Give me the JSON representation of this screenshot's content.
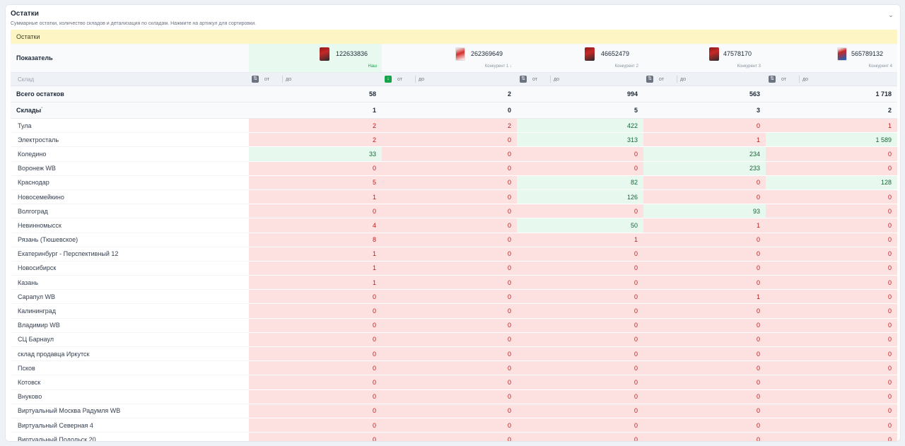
{
  "card": {
    "title": "Остатки",
    "subtitle": "Суммарные остатки, количество складов и детализация по складам. Нажмите на артикул для сортировки.",
    "collapse_glyph": "⌄"
  },
  "section_label": "Остатки",
  "header_label": "Показатель",
  "products": [
    {
      "article": "122633836",
      "role": "Наш",
      "ours": true
    },
    {
      "article": "262369649",
      "role": "Конкурент 1 ↓",
      "ours": false
    },
    {
      "article": "46652479",
      "role": "Конкурент 2",
      "ours": false
    },
    {
      "article": "47578170",
      "role": "Конкурент 3",
      "ours": false
    },
    {
      "article": "565789132",
      "role": "Конкурент 4",
      "ours": false
    }
  ],
  "filter": {
    "sklad_placeholder": "Склад",
    "from_placeholder": "от",
    "to_placeholder": "до",
    "sort_glyph": "⇅",
    "sort_active_glyph": "↓"
  },
  "totals": {
    "label": "Всего остатков",
    "values": [
      "58",
      "2",
      "994",
      "563",
      "1 718"
    ]
  },
  "warehouses_count": {
    "label": "Склады",
    "mark": "*",
    "values": [
      "1",
      "0",
      "5",
      "3",
      "2"
    ]
  },
  "rows": [
    {
      "name": "Тула",
      "values": [
        "2",
        "2",
        "422",
        "0",
        "1"
      ],
      "status": [
        "r",
        "r",
        "g",
        "r",
        "r"
      ]
    },
    {
      "name": "Электросталь",
      "values": [
        "2",
        "0",
        "313",
        "1",
        "1 589"
      ],
      "status": [
        "r",
        "r",
        "g",
        "r",
        "g"
      ]
    },
    {
      "name": "Коледино",
      "values": [
        "33",
        "0",
        "0",
        "234",
        "0"
      ],
      "status": [
        "g",
        "r",
        "r",
        "g",
        "r"
      ]
    },
    {
      "name": "Воронеж WB",
      "values": [
        "0",
        "0",
        "0",
        "233",
        "0"
      ],
      "status": [
        "r",
        "r",
        "r",
        "g",
        "r"
      ]
    },
    {
      "name": "Краснодар",
      "values": [
        "5",
        "0",
        "82",
        "0",
        "128"
      ],
      "status": [
        "r",
        "r",
        "g",
        "r",
        "g"
      ]
    },
    {
      "name": "Новосемейкино",
      "values": [
        "1",
        "0",
        "126",
        "0",
        "0"
      ],
      "status": [
        "r",
        "r",
        "g",
        "r",
        "r"
      ]
    },
    {
      "name": "Волгоград",
      "values": [
        "0",
        "0",
        "0",
        "93",
        "0"
      ],
      "status": [
        "r",
        "r",
        "r",
        "g",
        "r"
      ]
    },
    {
      "name": "Невинномысск",
      "values": [
        "4",
        "0",
        "50",
        "1",
        "0"
      ],
      "status": [
        "r",
        "r",
        "g",
        "r",
        "r"
      ]
    },
    {
      "name": "Рязань (Тюшевское)",
      "values": [
        "8",
        "0",
        "1",
        "0",
        "0"
      ],
      "status": [
        "r",
        "r",
        "r",
        "r",
        "r"
      ]
    },
    {
      "name": "Екатеринбург - Перспективный 12",
      "values": [
        "1",
        "0",
        "0",
        "0",
        "0"
      ],
      "status": [
        "r",
        "r",
        "r",
        "r",
        "r"
      ]
    },
    {
      "name": "Новосибирск",
      "values": [
        "1",
        "0",
        "0",
        "0",
        "0"
      ],
      "status": [
        "r",
        "r",
        "r",
        "r",
        "r"
      ]
    },
    {
      "name": "Казань",
      "values": [
        "1",
        "0",
        "0",
        "0",
        "0"
      ],
      "status": [
        "r",
        "r",
        "r",
        "r",
        "r"
      ]
    },
    {
      "name": "Сарапул WB",
      "values": [
        "0",
        "0",
        "0",
        "1",
        "0"
      ],
      "status": [
        "r",
        "r",
        "r",
        "r",
        "r"
      ]
    },
    {
      "name": "Калининград",
      "values": [
        "0",
        "0",
        "0",
        "0",
        "0"
      ],
      "status": [
        "r",
        "r",
        "r",
        "r",
        "r"
      ]
    },
    {
      "name": "Владимир WB",
      "values": [
        "0",
        "0",
        "0",
        "0",
        "0"
      ],
      "status": [
        "r",
        "r",
        "r",
        "r",
        "r"
      ]
    },
    {
      "name": "СЦ Барнаул",
      "values": [
        "0",
        "0",
        "0",
        "0",
        "0"
      ],
      "status": [
        "r",
        "r",
        "r",
        "r",
        "r"
      ]
    },
    {
      "name": "склад продавца Иркутск",
      "values": [
        "0",
        "0",
        "0",
        "0",
        "0"
      ],
      "status": [
        "r",
        "r",
        "r",
        "r",
        "r"
      ]
    },
    {
      "name": "Псков",
      "values": [
        "0",
        "0",
        "0",
        "0",
        "0"
      ],
      "status": [
        "r",
        "r",
        "r",
        "r",
        "r"
      ]
    },
    {
      "name": "Котовск",
      "values": [
        "0",
        "0",
        "0",
        "0",
        "0"
      ],
      "status": [
        "r",
        "r",
        "r",
        "r",
        "r"
      ]
    },
    {
      "name": "Внуково",
      "values": [
        "0",
        "0",
        "0",
        "0",
        "0"
      ],
      "status": [
        "r",
        "r",
        "r",
        "r",
        "r"
      ]
    },
    {
      "name": "Виртуальный Москва Радумля WB",
      "values": [
        "0",
        "0",
        "0",
        "0",
        "0"
      ],
      "status": [
        "r",
        "r",
        "r",
        "r",
        "r"
      ]
    },
    {
      "name": "Виртуальный Северная 4",
      "values": [
        "0",
        "0",
        "0",
        "0",
        "0"
      ],
      "status": [
        "r",
        "r",
        "r",
        "r",
        "r"
      ]
    },
    {
      "name": "Виртуальный Подольск 20",
      "values": [
        "0",
        "0",
        "0",
        "0",
        "0"
      ],
      "status": [
        "r",
        "r",
        "r",
        "r",
        "r"
      ]
    }
  ],
  "colors": {
    "low": "#fde1e1",
    "high": "#e7f8ee",
    "band": "#fdf6c4",
    "ours_header": "#e8faf0"
  }
}
